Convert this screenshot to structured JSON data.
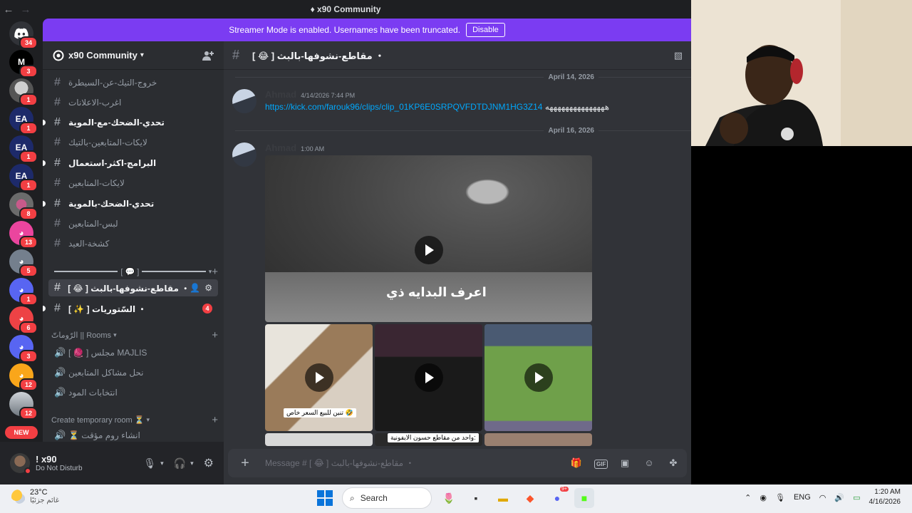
{
  "window": {
    "title": "x90 Community",
    "back": "←",
    "forward": "→"
  },
  "banner": {
    "text": "Streamer Mode is enabled. Usernames have been truncated.",
    "button": "Disable"
  },
  "rail": {
    "badges": [
      "34",
      "3",
      "1",
      "1",
      "1",
      "1",
      "8",
      "13",
      "5",
      "1",
      "6",
      "3",
      "12",
      "12"
    ],
    "labels": [
      "",
      "M",
      "",
      "EA",
      "EA",
      "EA",
      "",
      "",
      "",
      "",
      "",
      "",
      "",
      ""
    ],
    "new": "NEW"
  },
  "guild": {
    "name": "x90 Community"
  },
  "channels": [
    {
      "name": "خروج-التيك-عن-السيطرة",
      "state": "muted"
    },
    {
      "name": "اغرب-الاعلانات",
      "state": "muted"
    },
    {
      "name": "تحدي-الضحك-مع-الموية",
      "state": "unread"
    },
    {
      "name": "لايكات-المتابعين-بالتيك",
      "state": "muted"
    },
    {
      "name": "البرامج-اكثر-استعمال",
      "state": "unread"
    },
    {
      "name": "لايكات-المتابعين",
      "state": "muted"
    },
    {
      "name": "تحدي-الضحك-بالموية",
      "state": "unread"
    },
    {
      "name": "لبس-المتابعين",
      "state": "muted"
    },
    {
      "name": "كشخة-العيد",
      "state": "muted"
    }
  ],
  "category2": {
    "label": "[ 💬 ]"
  },
  "active_channel": "[ 😂 ] مقاطع-نشوفها-بالبث ・",
  "extra_channel": {
    "name": "[ ✨ ] السّتوريات ・",
    "badge": "4"
  },
  "rooms": {
    "category": "الرّوماتّ || Rooms",
    "items": [
      "[ 🧶 ] مجلس MAJLIS",
      "نحل مشاكل المتابعين",
      "انتخابات المود"
    ]
  },
  "temp": {
    "category": "Create temporary room ⏳",
    "item": "⏳ انشاء روم مؤقت"
  },
  "user": {
    "name": "! x90",
    "status": "Do Not Disturb"
  },
  "chat": {
    "channel": "[ 😂 ] مقاطع-نشوفها-بالبث ・",
    "dividers": [
      "April 14, 2026",
      "April 16, 2026"
    ],
    "messages": [
      {
        "author": "Ahmad",
        "time": "4/14/2026 7:44 PM",
        "link": "https://kick.com/farouk96/clips/clip_01KP6E0SRPQVFDTDJNM1HG3Z14",
        "tail": "هههههههههههههههه"
      },
      {
        "author": "Ahmad",
        "time": "1:00 AM"
      }
    ],
    "video_caption": "اعرف البدايه ذي",
    "thumb_captions": [
      "تنين للبيع السعر خاص 🤣",
      "واحد من مقاطع حسون الايفونية:"
    ],
    "placeholder": "Message # [ 😂 ] مقاطع-نشوفها-بالبث ・",
    "gif": "GIF"
  },
  "taskbar": {
    "temp": "23°C",
    "weather": "غائم جزئيًا",
    "search": "Search",
    "lang": "ENG",
    "time": "1:20 AM",
    "date": "4/16/2026",
    "discord_badge": "9+"
  }
}
